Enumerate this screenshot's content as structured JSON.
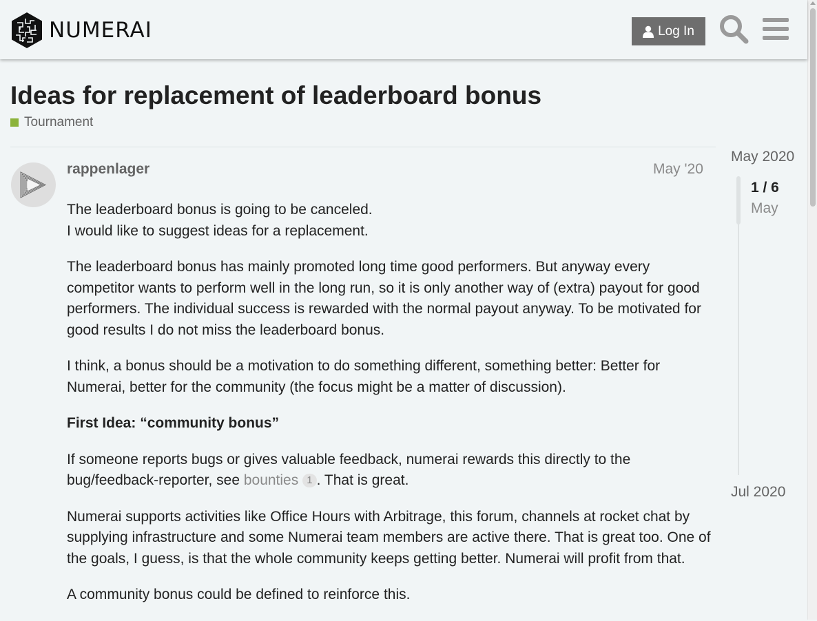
{
  "header": {
    "logo_text": "NUMERAI",
    "login_label": "Log In",
    "icons": {
      "search": "search-icon",
      "menu": "hamburger-menu-icon",
      "user": "user-icon"
    }
  },
  "topic": {
    "title": "Ideas for replacement of leaderboard bonus",
    "category": {
      "label": "Tournament",
      "color": "#8cb33b"
    }
  },
  "post": {
    "username": "rappenlager",
    "date": "May '20",
    "p1_line1": "The leaderboard bonus is going to be canceled.",
    "p1_line2": "I would like to suggest ideas for a replacement.",
    "p2": "The leaderboard bonus has mainly promoted long time good performers. But anyway every competitor wants to perform well in the long run, so it is only another way of (extra) payout for good performers. The individual success is rewarded with the normal payout anyway. To be motivated for good results I do not miss the leaderboard bonus.",
    "p3": "I think, a bonus should be a motivation to do something different, something better: Better for Numerai, better for the community (the focus might be a matter of discussion).",
    "p4_heading": "First Idea: “community bonus”",
    "p5_before": "If someone reports bugs or gives valuable feedback, numerai rewards this directly to the bug/feedback-reporter, see ",
    "p5_link": "bounties",
    "p5_link_count": "1",
    "p5_after": ". That is great.",
    "p6": "Numerai supports activities like Office Hours with Arbitrage, this forum, channels at rocket chat by supplying infrastructure and some Numerai team members are active there. That is great too. One of the goals, I guess, is that the whole community keeps getting better. Numerai will profit from that.",
    "p7": "A community bonus could be defined to reinforce this."
  },
  "timeline": {
    "start": "May 2020",
    "position": "1 / 6",
    "position_month": "May",
    "end": "Jul 2020"
  }
}
